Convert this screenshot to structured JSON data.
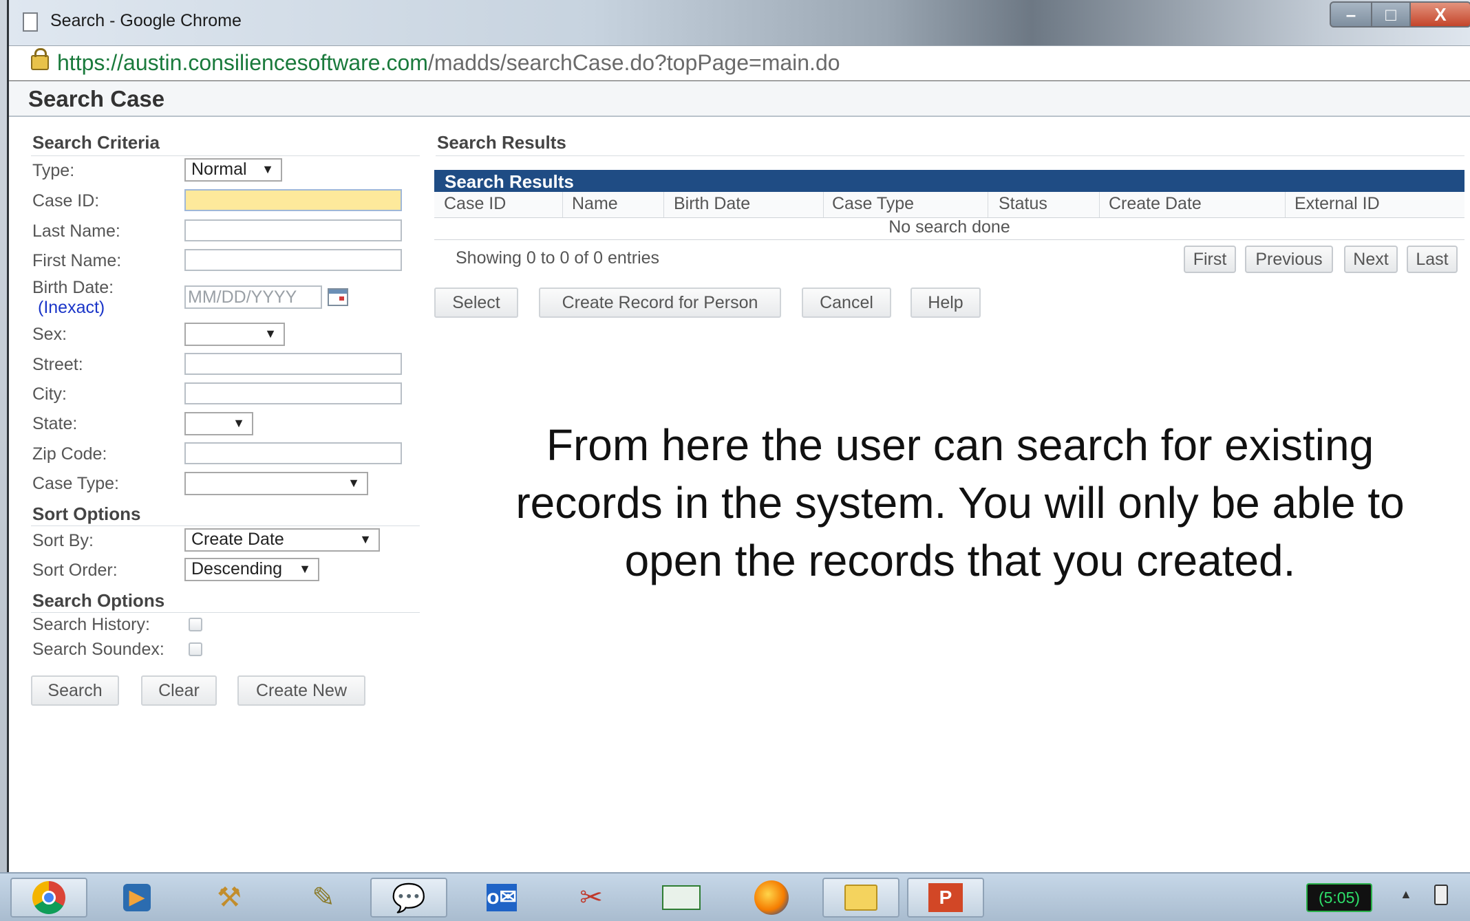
{
  "window": {
    "title": "Search - Google Chrome",
    "controls": [
      "–",
      "□",
      "X"
    ]
  },
  "addressbar": {
    "url_host": "https://austin.consiliencesoftware.com",
    "url_path": "/madds/searchCase.do?topPage=main.do"
  },
  "page": {
    "title": "Search Case"
  },
  "criteria": {
    "section_title": "Search Criteria",
    "type_label": "Type:",
    "type_value": "Normal",
    "case_id_label": "Case ID:",
    "last_name_label": "Last Name:",
    "first_name_label": "First Name:",
    "birth_date_label": "Birth Date:",
    "inexact_label": "(Inexact)",
    "birth_date_placeholder": "MM/DD/YYYY",
    "sex_label": "Sex:",
    "street_label": "Street:",
    "city_label": "City:",
    "state_label": "State:",
    "zip_label": "Zip Code:",
    "case_type_label": "Case Type:"
  },
  "sort": {
    "section_title": "Sort Options",
    "sort_by_label": "Sort By:",
    "sort_by_value": "Create Date",
    "sort_order_label": "Sort Order:",
    "sort_order_value": "Descending"
  },
  "search_options": {
    "section_title": "Search Options",
    "history_label": "Search History:",
    "soundex_label": "Search Soundex:"
  },
  "left_buttons": {
    "search": "Search",
    "clear": "Clear",
    "create_new": "Create New"
  },
  "results": {
    "section_title": "Search Results",
    "table_title": "Search Results",
    "columns": [
      "Case ID",
      "Name",
      "Birth Date",
      "Case Type",
      "Status",
      "Create Date",
      "External ID"
    ],
    "empty_message": "No search done",
    "showing": "Showing 0 to 0 of 0 entries",
    "pagination": {
      "first": "First",
      "previous": "Previous",
      "next": "Next",
      "last": "Last"
    },
    "actions": {
      "select": "Select",
      "create_record": "Create Record for Person",
      "cancel": "Cancel",
      "help": "Help"
    }
  },
  "annotation": "From here the user can search for existing records in the system. You will only be able to open the records that you created.",
  "taskbar": {
    "items": [
      "chrome-icon",
      "media-player-icon",
      "tools-icon",
      "notes-icon",
      "chat-icon",
      "outlook-icon",
      "scissors-icon",
      "presentation-icon",
      "firefox-icon",
      "folders-icon",
      "powerpoint-icon"
    ],
    "battery_text": "(5:05)",
    "tray_arrow": "▲"
  },
  "colors": {
    "results_header": "#1f4c84",
    "active_input": "#fde99b",
    "link": "#1a35c8"
  }
}
